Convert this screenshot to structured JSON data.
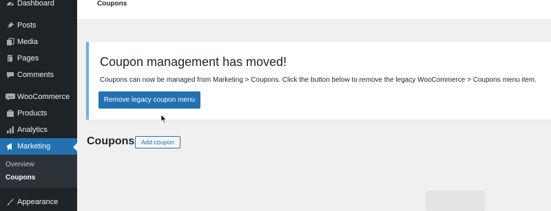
{
  "sidebar": {
    "items": [
      {
        "label": "Dashboard",
        "icon": "dashboard-icon"
      },
      {
        "label": "Posts",
        "icon": "pushpin-icon"
      },
      {
        "label": "Media",
        "icon": "media-icon"
      },
      {
        "label": "Pages",
        "icon": "pages-icon"
      },
      {
        "label": "Comments",
        "icon": "comment-icon"
      },
      {
        "label": "WooCommerce",
        "icon": "woocommerce-icon"
      },
      {
        "label": "Products",
        "icon": "products-icon"
      },
      {
        "label": "Analytics",
        "icon": "analytics-icon"
      },
      {
        "label": "Marketing",
        "icon": "megaphone-icon"
      },
      {
        "label": "Appearance",
        "icon": "brush-icon"
      }
    ],
    "submenu": [
      {
        "label": "Overview"
      },
      {
        "label": "Coupons"
      }
    ],
    "active_color": "#2271b1"
  },
  "header": {
    "title": "Coupons"
  },
  "notice": {
    "heading": "Coupon management has moved!",
    "body": "Coupons can now be managed from Marketing > Coupons. Click the button below to remove the legacy WooCommerce > Coupons menu item.",
    "button_label": "Remove legacy coupon menu",
    "accent_color": "#72aee6"
  },
  "main": {
    "heading": "Coupons",
    "add_button_label": "Add coupon"
  }
}
